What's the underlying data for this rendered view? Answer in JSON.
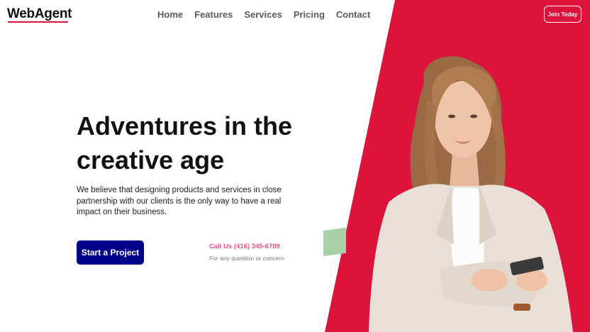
{
  "brand": {
    "logo_text": "WebAgent",
    "accent": "#dc143c"
  },
  "nav": {
    "items": [
      {
        "label": "Home"
      },
      {
        "label": "Features"
      },
      {
        "label": "Services"
      },
      {
        "label": "Pricing"
      },
      {
        "label": "Contact"
      }
    ],
    "join_label": "Join Today"
  },
  "hero": {
    "title_line1": "Adventures in the",
    "title_line2": "creative age",
    "description": "We believe that designing products and services in close partnership with our clients is the only way to have a real impact on their business.",
    "cta_label": "Start a Project",
    "cta_color": "#00008b",
    "call_text": "Call Us (416) 345-6789",
    "call_subtext": "For any question or concern"
  },
  "colors": {
    "panel": "#dc143c",
    "green_shape": "#a9cfa6"
  }
}
